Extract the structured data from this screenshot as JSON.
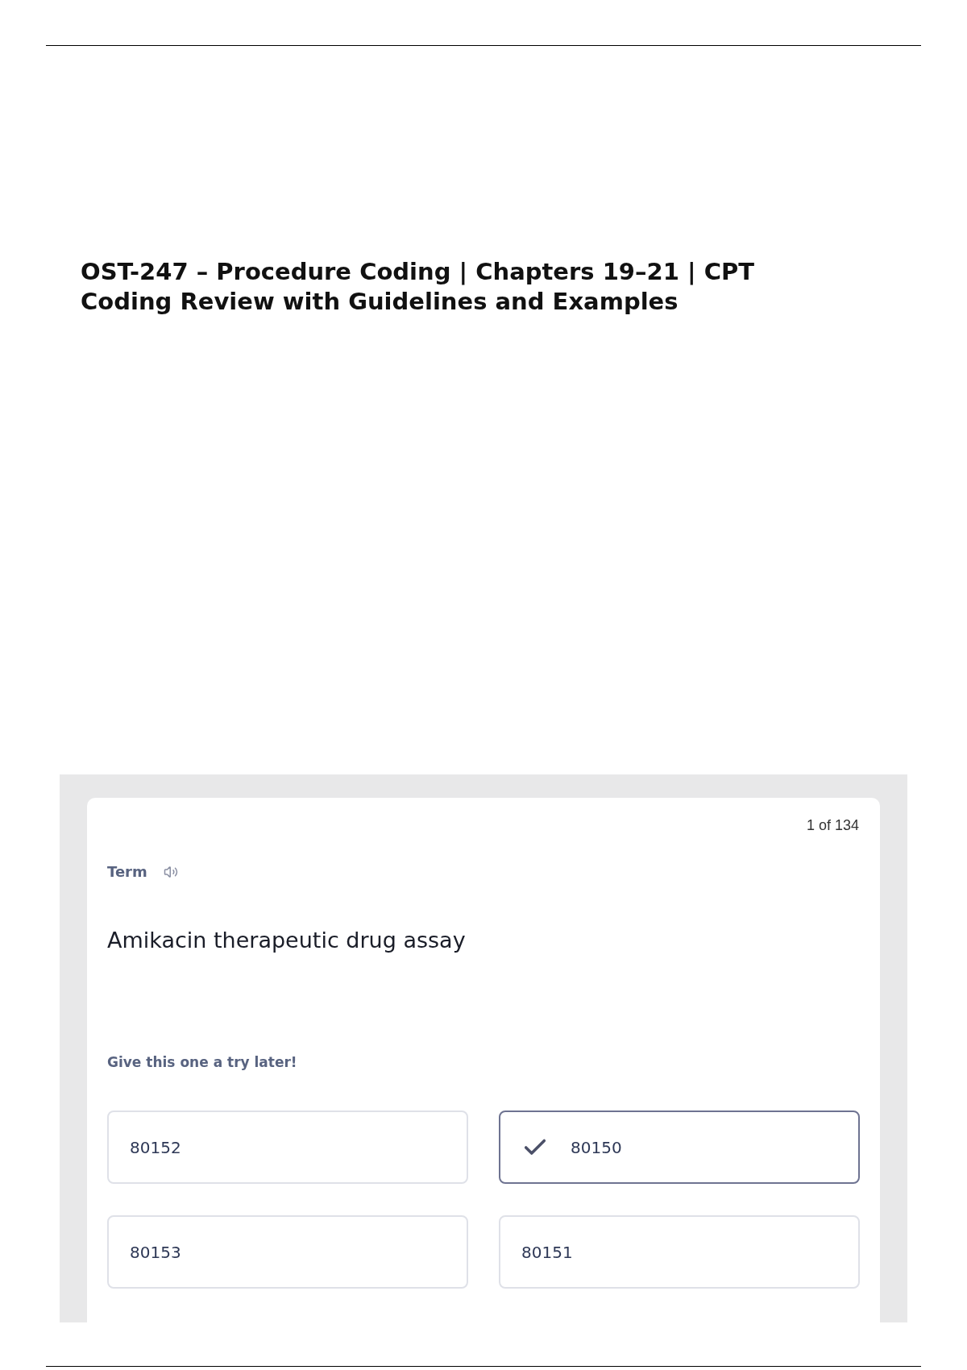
{
  "document": {
    "title": "OST-247 – Procedure Coding | Chapters 19–21 | CPT Coding Review with Guidelines and Examples"
  },
  "flashcard": {
    "progress": "1 of 134",
    "label": "Term",
    "term": "Amikacin therapeutic drug assay",
    "hint": "Give this one a try later!",
    "options": [
      {
        "text": "80152",
        "selected": false
      },
      {
        "text": "80150",
        "selected": true
      },
      {
        "text": "80153",
        "selected": false
      },
      {
        "text": "80151",
        "selected": false
      }
    ]
  }
}
